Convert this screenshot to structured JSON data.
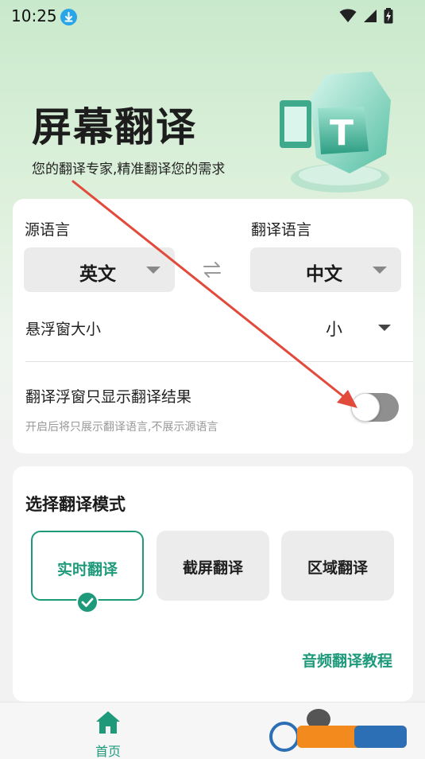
{
  "status_bar": {
    "time": "10:25",
    "icons": [
      "download-badge-icon",
      "wifi-icon",
      "signal-icon",
      "battery-charging-icon"
    ]
  },
  "header": {
    "title": "屏幕翻译",
    "subtitle": "您的翻译专家,精准翻译您的需求"
  },
  "language_card": {
    "source_label": "源语言",
    "source_value": "英文",
    "target_label": "翻译语言",
    "target_value": "中文",
    "swap_icon": "swap-icon",
    "float_size_label": "悬浮窗大小",
    "float_size_value": "小",
    "only_result_label": "翻译浮窗只显示翻译结果",
    "only_result_hint": "开启后将只展示翻译语言,不展示源语言",
    "only_result_enabled": false
  },
  "mode_card": {
    "title": "选择翻译模式",
    "modes": [
      {
        "label": "实时翻译",
        "selected": true
      },
      {
        "label": "截屏翻译",
        "selected": false
      },
      {
        "label": "区域翻译",
        "selected": false
      }
    ],
    "tutorial_link": "音频翻译教程"
  },
  "bottom_nav": {
    "home_label": "首页"
  },
  "colors": {
    "accent": "#1e9a7b",
    "annotation_arrow": "#e24a3b",
    "toggle_off": "#8f8f8f"
  }
}
